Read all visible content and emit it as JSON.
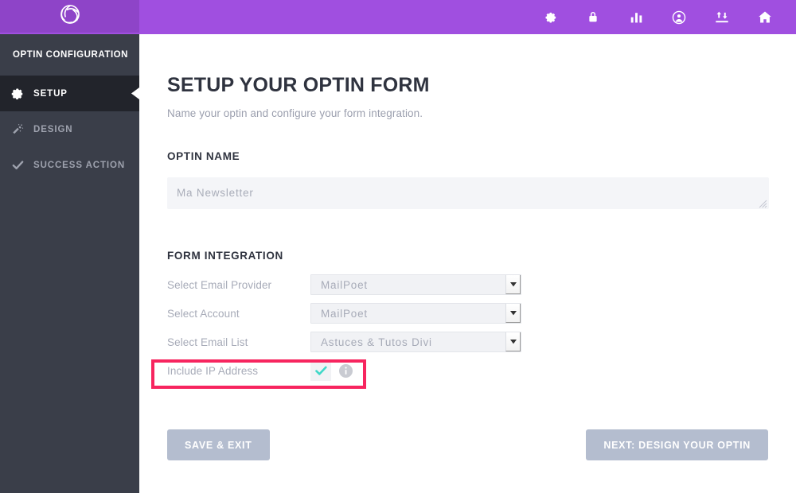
{
  "header": {
    "icons": [
      {
        "name": "settings-icon",
        "title": "Settings"
      },
      {
        "name": "lock-icon",
        "title": "Security"
      },
      {
        "name": "bar-chart-icon",
        "title": "Statistics"
      },
      {
        "name": "user-circle-icon",
        "title": "Account"
      },
      {
        "name": "import-export-icon",
        "title": "Import / Export"
      },
      {
        "name": "home-icon",
        "title": "Home"
      }
    ],
    "background_color": "#a04fe0"
  },
  "sidebar": {
    "logo_name": "bloom-logo",
    "logo_background": "#8e44c8",
    "title": "OPTIN CONFIGURATION",
    "background_color": "#3a3e49",
    "active_background_color": "#22242b",
    "items": [
      {
        "label": "SETUP",
        "icon": "gear-icon",
        "active": true
      },
      {
        "label": "DESIGN",
        "icon": "magic-wand-icon",
        "active": false
      },
      {
        "label": "SUCCESS ACTION",
        "icon": "check-icon",
        "active": false
      }
    ]
  },
  "main": {
    "title": "SETUP YOUR OPTIN FORM",
    "subtitle": "Name your optin and configure your form integration.",
    "optin_name": {
      "heading": "OPTIN NAME",
      "value": "Ma Newsletter",
      "placeholder": "Ma Newsletter"
    },
    "form_integration": {
      "heading": "FORM INTEGRATION",
      "fields": [
        {
          "label": "Select Email Provider",
          "value": "MailPoet",
          "type": "select"
        },
        {
          "label": "Select Account",
          "value": "MailPoet",
          "type": "select"
        },
        {
          "label": "Select Email List",
          "value": "Astuces & Tutos Divi",
          "type": "select"
        },
        {
          "label": "Include IP Address",
          "value": "checked",
          "type": "checkbox"
        }
      ]
    },
    "highlight": {
      "name": "include-ip-address-highlight",
      "color": "#f7255f"
    }
  },
  "footer": {
    "save_label": "SAVE & EXIT",
    "next_label": "NEXT: DESIGN YOUR OPTIN",
    "button_color": "#b4bdcf"
  },
  "colors": {
    "accent_purple": "#a04fe0",
    "logo_purple": "#8e44c8",
    "sidebar_dark": "#3a3e49",
    "sidebar_active": "#22242b",
    "checkmark_teal": "#3fd8c8",
    "highlight_pink": "#f7255f",
    "button_gray": "#b4bdcf"
  }
}
